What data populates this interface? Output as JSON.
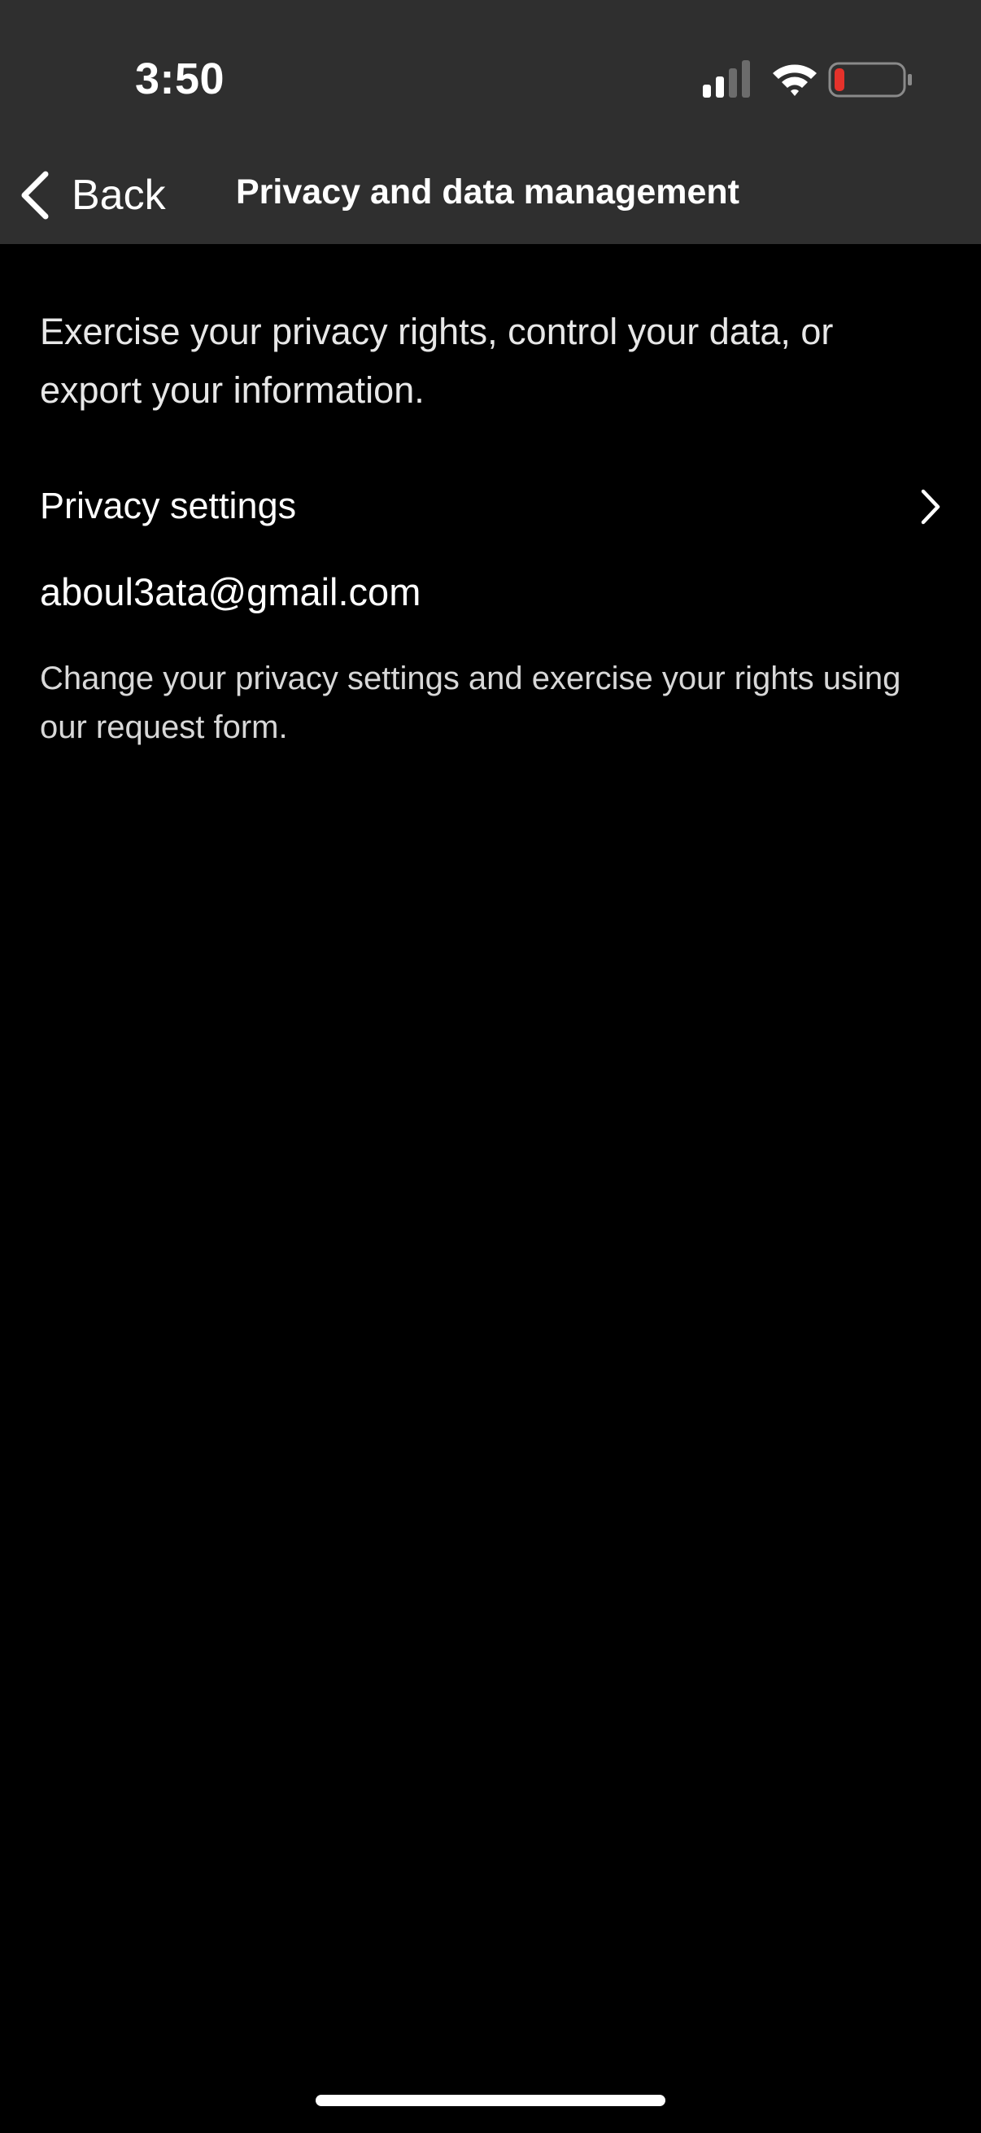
{
  "status_bar": {
    "time": "3:50",
    "signal_icon": "cellular-signal-icon",
    "wifi_icon": "wifi-icon",
    "battery_icon": "battery-low-icon",
    "battery_color": "#e5322b"
  },
  "nav": {
    "back_label": "Back",
    "title": "Privacy and data management"
  },
  "content": {
    "intro": "Exercise your privacy rights, control your data, or export your information.",
    "privacy_settings_label": "Privacy settings",
    "email": "aboul3ata@gmail.com",
    "help_text": "Change your privacy settings and exercise your rights using our request form."
  },
  "colors": {
    "header_bg": "#2f2f2f",
    "page_bg": "#000000",
    "text": "#ffffff"
  }
}
